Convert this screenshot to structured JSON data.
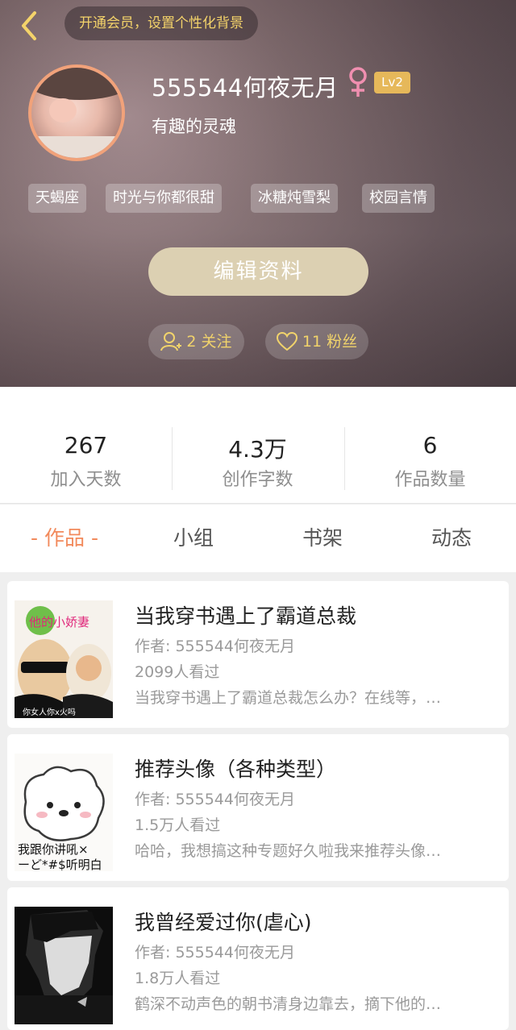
{
  "header": {
    "vip_banner": "开通会员，设置个性化背景",
    "username": "555544何夜无月",
    "level": "Lv2",
    "signature": "有趣的灵魂",
    "tags": [
      "天蝎座",
      "时光与你都很甜",
      "冰糖炖雪梨",
      "校园言情"
    ],
    "edit_button": "编辑资料",
    "following": "2 关注",
    "followers": "11 粉丝"
  },
  "stats": [
    {
      "value": "267",
      "label": "加入天数"
    },
    {
      "value": "4.3万",
      "label": "创作字数"
    },
    {
      "value": "6",
      "label": "作品数量"
    }
  ],
  "tabs": [
    "- 作品 -",
    "小组",
    "书架",
    "动态"
  ],
  "works": [
    {
      "title": "当我穿书遇上了霸道总裁",
      "author": "作者: 555544何夜无月",
      "views": "2099人看过",
      "desc": "当我穿书遇上了霸道总裁怎么办？在线等，…",
      "cover_text_top": "他的小娇妻",
      "cover_text_bottom": "你女人你x火吗"
    },
    {
      "title": "推荐头像（各种类型）",
      "author": "作者: 555544何夜无月",
      "views": "1.5万人看过",
      "desc": "哈哈，我想搞这种专题好久啦我来推荐头像…",
      "cover_text_top": "我跟你讲吼×",
      "cover_text_bottom": "ーど*#$听明白"
    },
    {
      "title": "我曾经爱过你(虐心)",
      "author": "作者: 555544何夜无月",
      "views": "1.8万人看过",
      "desc": "鹤深不动声色的朝书清身边靠去，摘下他的…"
    }
  ],
  "colors": {
    "accent": "#f28a5c",
    "gold": "#f4d36a",
    "edit_button": "#dcd0b2"
  }
}
